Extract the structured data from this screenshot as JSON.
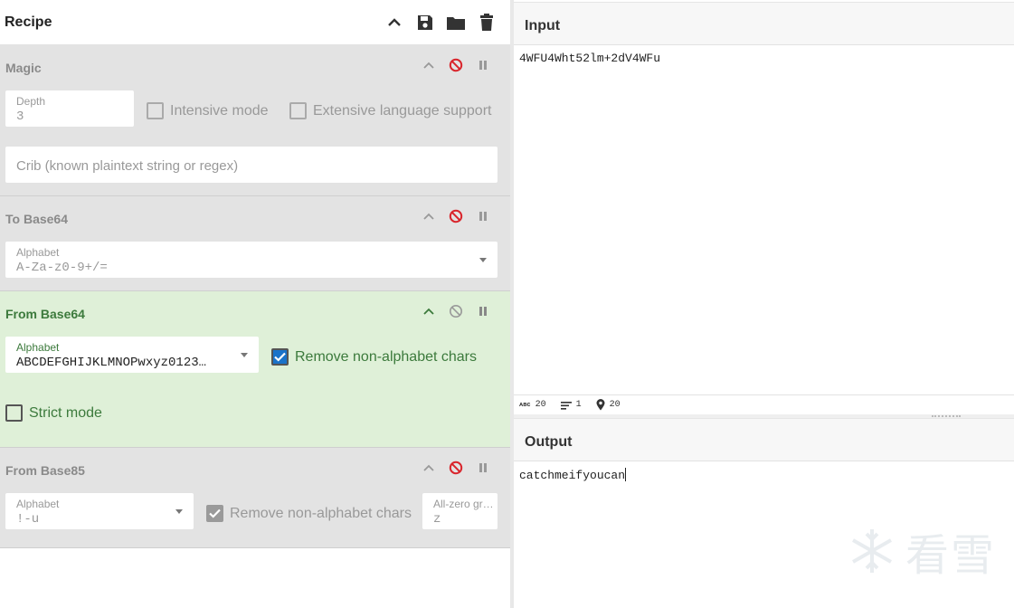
{
  "recipe": {
    "title": "Recipe",
    "operations": [
      {
        "name": "Magic",
        "fields": {
          "depth_label": "Depth",
          "depth_value": "3",
          "crib_placeholder": "Crib (known plaintext string or regex)"
        },
        "checks": {
          "intensive": "Intensive mode",
          "extensive": "Extensive language support"
        }
      },
      {
        "name": "To Base64",
        "fields": {
          "alphabet_label": "Alphabet",
          "alphabet_value": "A-Za-z0-9+/="
        }
      },
      {
        "name": "From Base64",
        "fields": {
          "alphabet_label": "Alphabet",
          "alphabet_value": "ABCDEFGHIJKLMNOPwxyz0123…"
        },
        "checks": {
          "remove_non_alpha": "Remove non-alphabet chars",
          "strict": "Strict mode"
        }
      },
      {
        "name": "From Base85",
        "fields": {
          "alphabet_label": "Alphabet",
          "alphabet_value": "!-u",
          "allzero_label": "All-zero gr…",
          "allzero_value": "z"
        },
        "checks": {
          "remove_non_alpha": "Remove non-alphabet chars"
        }
      }
    ]
  },
  "input": {
    "title": "Input",
    "text": "4WFU4Wht52lm+2dV4WFu"
  },
  "status": {
    "chars": "20",
    "lines": "1",
    "position": "20"
  },
  "output": {
    "title": "Output",
    "text": "catchmeifyoucan"
  },
  "watermark": {
    "text": "看雪"
  },
  "colors": {
    "active_bg": "#dff0d8",
    "disabled_bg": "#e3e3e3",
    "checkbox_blue": "#1a73c9",
    "disable_red": "#d9252c"
  }
}
